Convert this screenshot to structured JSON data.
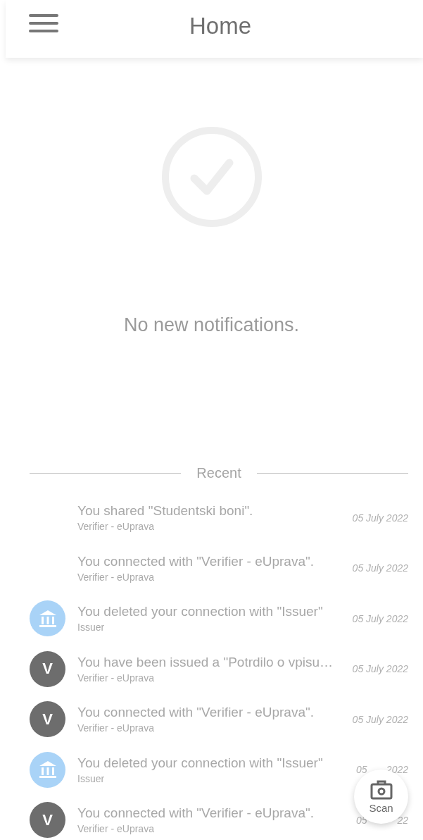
{
  "header": {
    "title": "Home"
  },
  "empty_state": {
    "message": "No new notifications."
  },
  "recent": {
    "heading": "Recent",
    "items": [
      {
        "avatar": {
          "kind": "none"
        },
        "title": "You shared \"Studentski boni\".",
        "subtitle": "Verifier - eUprava",
        "date": "05 July 2022"
      },
      {
        "avatar": {
          "kind": "none"
        },
        "title": "You connected with \"Verifier - eUprava\".",
        "subtitle": "Verifier - eUprava",
        "date": "05 July 2022"
      },
      {
        "avatar": {
          "kind": "bank"
        },
        "title": "You deleted your connection with \"Issuer\"",
        "subtitle": "Issuer",
        "date": "05 July 2022"
      },
      {
        "avatar": {
          "kind": "letter",
          "letter": "V"
        },
        "title": "You have been issued a \"Potrdilo o vpisu…",
        "subtitle": "Verifier - eUprava",
        "date": "05 July 2022"
      },
      {
        "avatar": {
          "kind": "letter",
          "letter": "V"
        },
        "title": "You connected with \"Verifier - eUprava\".",
        "subtitle": "Verifier - eUprava",
        "date": "05 July 2022"
      },
      {
        "avatar": {
          "kind": "bank"
        },
        "title": "You deleted your connection with \"Issuer\"",
        "subtitle": "Issuer",
        "date": "05",
        "date_end": "2022"
      },
      {
        "avatar": {
          "kind": "letter",
          "letter": "V"
        },
        "title": "You connected with \"Verifier - eUprava\".",
        "subtitle": "Verifier - eUprava",
        "date": "05",
        "date_end": "22"
      }
    ]
  },
  "scan_button": {
    "label": "Scan"
  }
}
